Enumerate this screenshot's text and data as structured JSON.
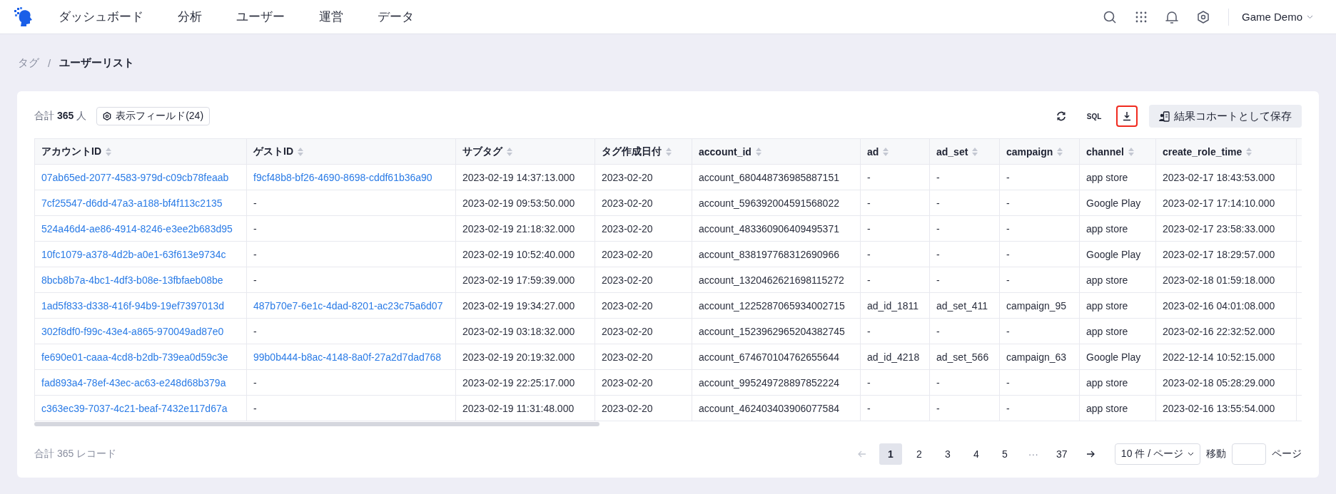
{
  "nav": {
    "items": [
      "ダッシュボード",
      "分析",
      "ユーザー",
      "運営",
      "データ"
    ],
    "project": "Game Demo"
  },
  "breadcrumb": {
    "separator": "/",
    "items": [
      "タグ",
      "ユーザーリスト"
    ]
  },
  "summary": {
    "prefix": "合計",
    "count": "365",
    "unit": "人"
  },
  "fields_button": "表示フィールド(24)",
  "toolbar": [
    {
      "kind": "refresh",
      "highlighted": false
    },
    {
      "kind": "sql",
      "label": "SQL",
      "highlighted": false
    },
    {
      "kind": "download",
      "highlighted": true
    }
  ],
  "save_button": "結果コホートとして保存",
  "table": {
    "columns": [
      {
        "label": "アカウントID",
        "kind": "link"
      },
      {
        "label": "ゲストID",
        "kind": "link"
      },
      {
        "label": "サブタグ",
        "kind": "text"
      },
      {
        "label": "タグ作成日付",
        "kind": "text"
      },
      {
        "label": "account_id",
        "kind": "text"
      },
      {
        "label": "ad",
        "kind": "text"
      },
      {
        "label": "ad_set",
        "kind": "text"
      },
      {
        "label": "campaign",
        "kind": "text"
      },
      {
        "label": "channel",
        "kind": "text"
      },
      {
        "label": "create_role_time",
        "kind": "text"
      }
    ],
    "rows": [
      [
        "07ab65ed-2077-4583-979d-c09cb78feaab",
        "f9cf48b8-bf26-4690-8698-cddf61b36a90",
        "2023-02-19 14:37:13.000",
        "2023-02-20",
        "account_680448736985887151",
        "-",
        "-",
        "-",
        "app store",
        "2023-02-17 18:43:53.000"
      ],
      [
        "7cf25547-d6dd-47a3-a188-bf4f113c2135",
        "-",
        "2023-02-19 09:53:50.000",
        "2023-02-20",
        "account_596392004591568022",
        "-",
        "-",
        "-",
        "Google Play",
        "2023-02-17 17:14:10.000"
      ],
      [
        "524a46d4-ae86-4914-8246-e3ee2b683d95",
        "-",
        "2023-02-19 21:18:32.000",
        "2023-02-20",
        "account_483360906409495371",
        "-",
        "-",
        "-",
        "app store",
        "2023-02-17 23:58:33.000"
      ],
      [
        "10fc1079-a378-4d2b-a0e1-63f613e9734c",
        "-",
        "2023-02-19 10:52:40.000",
        "2023-02-20",
        "account_838197768312690966",
        "-",
        "-",
        "-",
        "Google Play",
        "2023-02-17 18:29:57.000"
      ],
      [
        "8bcb8b7a-4bc1-4df3-b08e-13fbfaeb08be",
        "-",
        "2023-02-19 17:59:39.000",
        "2023-02-20",
        "account_1320462621698115272",
        "-",
        "-",
        "-",
        "app store",
        "2023-02-18 01:59:18.000"
      ],
      [
        "1ad5f833-d338-416f-94b9-19ef7397013d",
        "487b70e7-6e1c-4dad-8201-ac23c75a6d07",
        "2023-02-19 19:34:27.000",
        "2023-02-20",
        "account_1225287065934002715",
        "ad_id_1811",
        "ad_set_411",
        "campaign_95",
        "app store",
        "2023-02-16 04:01:08.000"
      ],
      [
        "302f8df0-f99c-43e4-a865-970049ad87e0",
        "-",
        "2023-02-19 03:18:32.000",
        "2023-02-20",
        "account_1523962965204382745",
        "-",
        "-",
        "-",
        "app store",
        "2023-02-16 22:32:52.000"
      ],
      [
        "fe690e01-caaa-4cd8-b2db-739ea0d59c3e",
        "99b0b444-b8ac-4148-8a0f-27a2d7dad768",
        "2023-02-19 20:19:32.000",
        "2023-02-20",
        "account_674670104762655644",
        "ad_id_4218",
        "ad_set_566",
        "campaign_63",
        "Google Play",
        "2022-12-14 10:52:15.000"
      ],
      [
        "fad893a4-78ef-43ec-ac63-e248d68b379a",
        "-",
        "2023-02-19 22:25:17.000",
        "2023-02-20",
        "account_995249728897852224",
        "-",
        "-",
        "-",
        "app store",
        "2023-02-18 05:28:29.000"
      ],
      [
        "c363ec39-7037-4c21-beaf-7432e117d67a",
        "-",
        "2023-02-19 11:31:48.000",
        "2023-02-20",
        "account_462403403906077584",
        "-",
        "-",
        "-",
        "app store",
        "2023-02-16 13:55:54.000"
      ]
    ]
  },
  "footer": {
    "total": "合計 365 レコード",
    "pagination": {
      "prev_disabled": true,
      "next_disabled": false,
      "pages": [
        {
          "label": "1",
          "kind": "page",
          "selected": true
        },
        {
          "label": "2",
          "kind": "page",
          "selected": false
        },
        {
          "label": "3",
          "kind": "page",
          "selected": false
        },
        {
          "label": "4",
          "kind": "page",
          "selected": false
        },
        {
          "label": "5",
          "kind": "page",
          "selected": false
        },
        {
          "label": "···",
          "kind": "ellipsis"
        },
        {
          "label": "37",
          "kind": "page",
          "selected": false
        }
      ]
    },
    "page_size": "10 件 / ページ",
    "jump_label": "移動",
    "jump_suffix": "ページ"
  }
}
